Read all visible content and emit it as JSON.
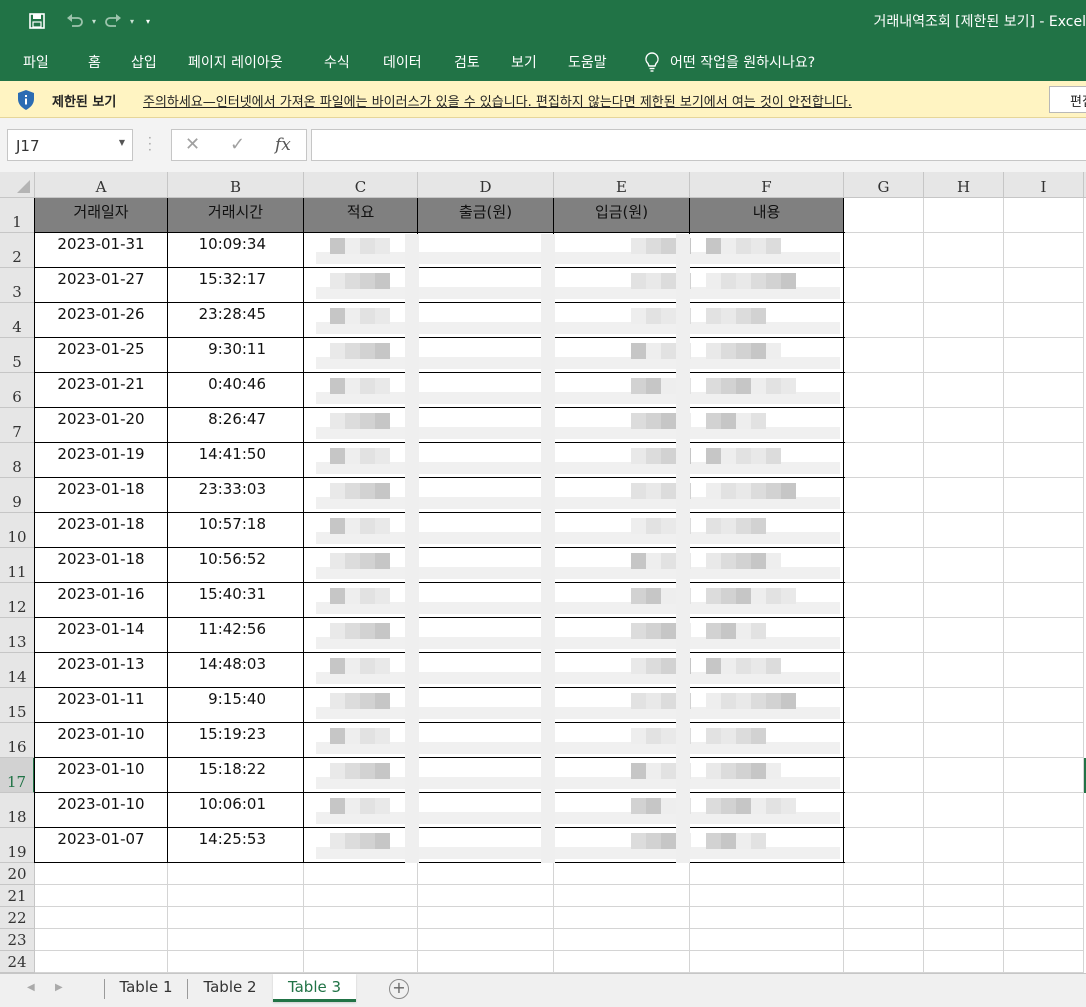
{
  "window": {
    "title": "거래내역조회  [제한된 보기]  -  Excel"
  },
  "ribbon": {
    "tabs": [
      "파일",
      "홈",
      "삽입",
      "페이지 레이아웃",
      "수식",
      "데이터",
      "검토",
      "보기",
      "도움말"
    ],
    "tell_me": "어떤 작업을 원하시나요?"
  },
  "message_bar": {
    "title": "제한된 보기",
    "text": "주의하세요—인터넷에서 가져온 파일에는 바이러스가 있을 수 있습니다. 편집하지 않는다면 제한된 보기에서 여는 것이 안전합니다.",
    "button": "편집 사용"
  },
  "formula_bar": {
    "name_box": "J17",
    "fx": "fx",
    "value": ""
  },
  "columns": [
    "A",
    "B",
    "C",
    "D",
    "E",
    "F",
    "G",
    "H",
    "I"
  ],
  "table": {
    "headers": [
      "거래일자",
      "거래시간",
      "적요",
      "출금(원)",
      "입금(원)",
      "내용"
    ],
    "rows": [
      [
        "2023-01-31",
        "10:09:34"
      ],
      [
        "2023-01-27",
        "15:32:17"
      ],
      [
        "2023-01-26",
        "23:28:45"
      ],
      [
        "2023-01-25",
        "9:30:11"
      ],
      [
        "2023-01-21",
        "0:40:46"
      ],
      [
        "2023-01-20",
        "8:26:47"
      ],
      [
        "2023-01-19",
        "14:41:50"
      ],
      [
        "2023-01-18",
        "23:33:03"
      ],
      [
        "2023-01-18",
        "10:57:18"
      ],
      [
        "2023-01-18",
        "10:56:52"
      ],
      [
        "2023-01-16",
        "15:40:31"
      ],
      [
        "2023-01-14",
        "11:42:56"
      ],
      [
        "2023-01-13",
        "14:48:03"
      ],
      [
        "2023-01-11",
        "9:15:40"
      ],
      [
        "2023-01-10",
        "15:19:23"
      ],
      [
        "2023-01-10",
        "15:18:22"
      ],
      [
        "2023-01-10",
        "10:06:01"
      ],
      [
        "2023-01-07",
        "14:25:53"
      ]
    ]
  },
  "row_numbers": [
    "1",
    "2",
    "3",
    "4",
    "5",
    "6",
    "7",
    "8",
    "9",
    "10",
    "11",
    "12",
    "13",
    "14",
    "15",
    "16",
    "17",
    "18",
    "19",
    "20",
    "21",
    "22",
    "23",
    "24"
  ],
  "selected_cell": "J17",
  "sheets": [
    {
      "name": "Table 1",
      "active": false
    },
    {
      "name": "Table 2",
      "active": false
    },
    {
      "name": "Table 3",
      "active": true
    }
  ],
  "colors": {
    "excel_green": "#217346",
    "message_bar": "#fff4c2",
    "header_fill": "#808080"
  }
}
